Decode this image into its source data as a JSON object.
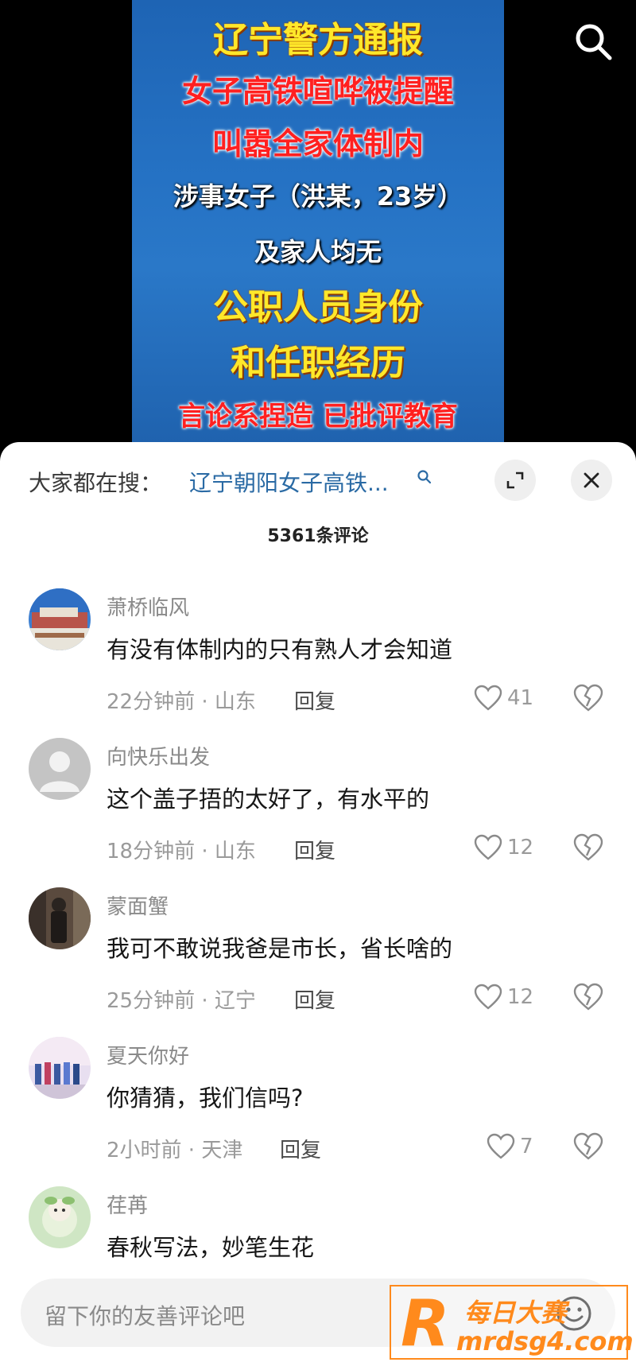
{
  "video": {
    "lines": [
      "辽宁警方通报",
      "女子高铁喧哗被提醒",
      "叫嚣全家体制内",
      "涉事女子（洪某，23岁）",
      "及家人均无",
      "公职人员身份",
      "和任职经历",
      "言论系捏造 已批评教育"
    ]
  },
  "sheet": {
    "hot_search_prefix": "大家都在搜：",
    "hot_search_term": "辽宁朝阳女子高铁...",
    "comment_count": "5361条评论"
  },
  "comments": [
    {
      "user": "萧桥临风",
      "text": "有没有体制内的只有熟人才会知道",
      "time_location": "22分钟前 · 山东",
      "reply": "回复",
      "likes": "41"
    },
    {
      "user": "向快乐出发",
      "text": "这个盖子捂的太好了，有水平的",
      "time_location": "18分钟前 · 山东",
      "reply": "回复",
      "likes": "12"
    },
    {
      "user": "蒙面蟹",
      "text": "我可不敢说我爸是市长，省长啥的",
      "time_location": "25分钟前 · 辽宁",
      "reply": "回复",
      "likes": "12"
    },
    {
      "user": "夏天你好",
      "text": "你猜猜，我们信吗?",
      "time_location": "2小时前 · 天津",
      "reply": "回复",
      "likes": "7"
    },
    {
      "user": "荏苒",
      "text": "春秋写法，妙笔生花"
    }
  ],
  "input": {
    "placeholder": "留下你的友善评论吧"
  },
  "watermark": {
    "logo": "R",
    "line1": "每日大赛",
    "line2": "mrdsg4.com"
  },
  "icons": {
    "search": "search-icon",
    "expand": "expand-icon",
    "close": "close-icon",
    "like": "heart-icon",
    "dislike": "broken-heart-icon",
    "emoji": "smiley-icon"
  },
  "colors": {
    "link": "#2a6aa4",
    "video_bg": "#2572c4",
    "caption_yellow": "#ffe82a",
    "caption_red": "#ff2020",
    "watermark": "#ff8a1c"
  }
}
